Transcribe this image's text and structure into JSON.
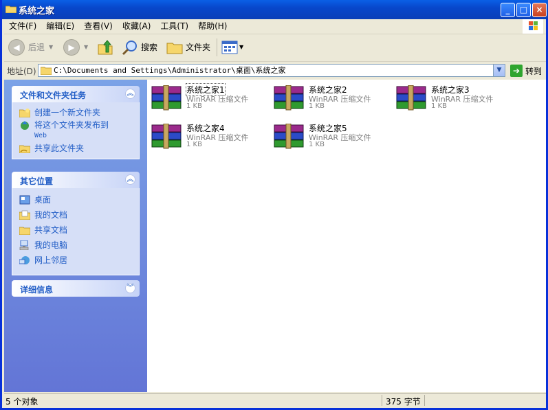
{
  "window": {
    "title": "系统之家"
  },
  "menu": [
    "文件(F)",
    "编辑(E)",
    "查看(V)",
    "收藏(A)",
    "工具(T)",
    "帮助(H)"
  ],
  "toolbar": {
    "back": "后退",
    "search": "搜索",
    "folders": "文件夹"
  },
  "address": {
    "label": "地址(D)",
    "value": "C:\\Documents and Settings\\Administrator\\桌面\\系统之家",
    "go": "转到"
  },
  "tasks_panel": {
    "title": "文件和文件夹任务",
    "items": [
      {
        "label": "创建一个新文件夹"
      },
      {
        "label": "将这个文件夹发布到",
        "sub": "Web"
      },
      {
        "label": "共享此文件夹"
      }
    ]
  },
  "places_panel": {
    "title": "其它位置",
    "items": [
      "桌面",
      "我的文档",
      "共享文档",
      "我的电脑",
      "网上邻居"
    ]
  },
  "details_panel": {
    "title": "详细信息"
  },
  "files": [
    {
      "name": "系统之家1",
      "type": "WinRAR 压缩文件",
      "size": "1 KB"
    },
    {
      "name": "系统之家2",
      "type": "WinRAR 压缩文件",
      "size": "1 KB"
    },
    {
      "name": "系统之家3",
      "type": "WinRAR 压缩文件",
      "size": "1 KB"
    },
    {
      "name": "系统之家4",
      "type": "WinRAR 压缩文件",
      "size": "1 KB"
    },
    {
      "name": "系统之家5",
      "type": "WinRAR 压缩文件",
      "size": "1 KB"
    }
  ],
  "status": {
    "objects": "5 个对象",
    "bytes": "375 字节"
  },
  "colors": {
    "titlebar": "#0a5fe6",
    "pane_blue": "#6f8fe0",
    "link": "#215dc6"
  }
}
